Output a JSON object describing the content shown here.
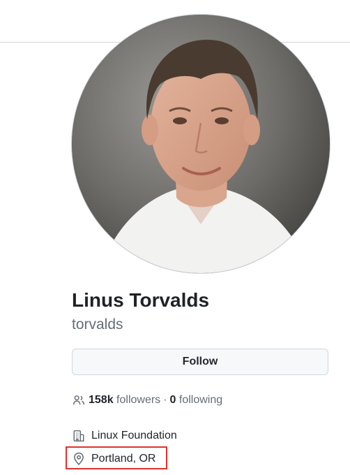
{
  "profile": {
    "name": "Linus Torvalds",
    "login": "torvalds",
    "follow_label": "Follow",
    "followers_count": "158k",
    "followers_label": "followers",
    "separator": "·",
    "following_count": "0",
    "following_label": "following",
    "organization": "Linux Foundation",
    "location": "Portland, OR"
  },
  "icons": {
    "people": "people-icon",
    "organization": "organization-icon",
    "location": "location-icon"
  },
  "colors": {
    "text": "#1f2328",
    "muted": "#656d76",
    "border": "#d0d7de",
    "button_bg": "#f6f8fa",
    "highlight": "#e0322f"
  }
}
